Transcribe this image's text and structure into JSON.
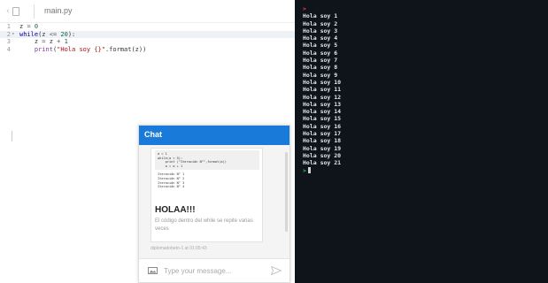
{
  "editor": {
    "file_tab": "main.py",
    "lines": [
      {
        "number": "1",
        "fold": "",
        "tokens": [
          {
            "t": "z ",
            "c": ""
          },
          {
            "t": "=",
            "c": "op"
          },
          {
            "t": " 0",
            "c": "num"
          }
        ]
      },
      {
        "number": "2",
        "fold": "▾",
        "tokens": [
          {
            "t": "while",
            "c": "kw"
          },
          {
            "t": "(z ",
            "c": ""
          },
          {
            "t": "<=",
            "c": "op"
          },
          {
            "t": " 20",
            "c": "num"
          },
          {
            "t": "):",
            "c": ""
          }
        ]
      },
      {
        "number": "3",
        "fold": "",
        "tokens": [
          {
            "t": "    z ",
            "c": ""
          },
          {
            "t": "=",
            "c": "op"
          },
          {
            "t": " z ",
            "c": ""
          },
          {
            "t": "+",
            "c": "op"
          },
          {
            "t": " 1",
            "c": "num"
          }
        ]
      },
      {
        "number": "4",
        "fold": "",
        "tokens": [
          {
            "t": "    ",
            "c": ""
          },
          {
            "t": "print",
            "c": "fn"
          },
          {
            "t": "(",
            "c": ""
          },
          {
            "t": "\"Hola soy {}\"",
            "c": "str"
          },
          {
            "t": ".format(z))",
            "c": ""
          }
        ]
      }
    ]
  },
  "console": {
    "top_prompt": ">",
    "lines": [
      "Hola soy 1",
      "Hola soy 2",
      "Hola soy 3",
      "Hola soy 4",
      "Hola soy 5",
      "Hola soy 6",
      "Hola soy 7",
      "Hola soy 8",
      "Hola soy 9",
      "Hola soy 10",
      "Hola soy 11",
      "Hola soy 12",
      "Hola soy 13",
      "Hola soy 14",
      "Hola soy 15",
      "Hola soy 16",
      "Hola soy 17",
      "Hola soy 18",
      "Hola soy 19",
      "Hola soy 20",
      "Hola soy 21"
    ],
    "bottom_prompt": ">"
  },
  "chat": {
    "title": "Chat",
    "message": {
      "snippet_code": [
        "a = 1",
        "while(a < 5):",
        "    print (\"Iteración N°\",format(a))",
        "    a = a + 1"
      ],
      "snippet_output": [
        "Iteración N° 1",
        "Iteración N° 2",
        "Iteración N° 3",
        "Iteración N° 4"
      ],
      "heading": "HOLAA!!!",
      "text": "El código dentro del while se repite varias veces",
      "meta": "diplomadobeto-1 at 01:05:43"
    },
    "input_placeholder": "Type your message...",
    "header_color": "#1a7ad9"
  }
}
